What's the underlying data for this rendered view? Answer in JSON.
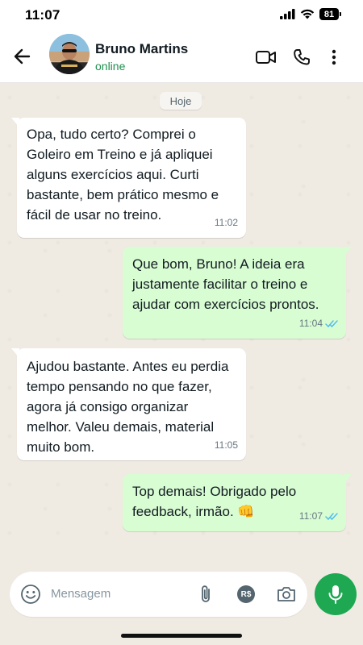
{
  "status_bar": {
    "time": "11:07",
    "battery": "81"
  },
  "header": {
    "contact_name": "Bruno Martins",
    "contact_status": "online",
    "status_color": "#1f8f4e"
  },
  "chat": {
    "date_label": "Hoje",
    "messages": [
      {
        "direction": "in",
        "text": "Opa, tudo certo? Comprei o Goleiro em Treino e já apliquei alguns exercícios aqui. Curti bastante, bem prático mesmo e fácil de usar no treino.",
        "time": "11:02"
      },
      {
        "direction": "out",
        "text": "Que bom, Bruno! A ideia era justamente facilitar o treino e ajudar com exercícios prontos.",
        "time": "11:04",
        "read": true
      },
      {
        "direction": "in",
        "text": "Ajudou bastante. Antes eu perdia tempo pensando no que fazer, agora já consigo organizar melhor. Valeu demais, material muito bom.",
        "time": "11:05"
      },
      {
        "direction": "out",
        "text": "Top demais! Obrigado pelo feedback, irmão. 👊",
        "time": "11:07",
        "read": true
      }
    ]
  },
  "composer": {
    "placeholder": "Mensagem",
    "currency_label": "R$"
  },
  "colors": {
    "accent_green": "#1da851",
    "outgoing_bubble": "#d9fdd3",
    "incoming_bubble": "#ffffff",
    "read_ticks": "#53bdeb"
  },
  "icons": [
    "back-arrow-icon",
    "video-call-icon",
    "voice-call-icon",
    "more-options-icon",
    "emoji-icon",
    "attach-icon",
    "payment-icon",
    "camera-icon",
    "mic-icon",
    "double-check-icon"
  ]
}
